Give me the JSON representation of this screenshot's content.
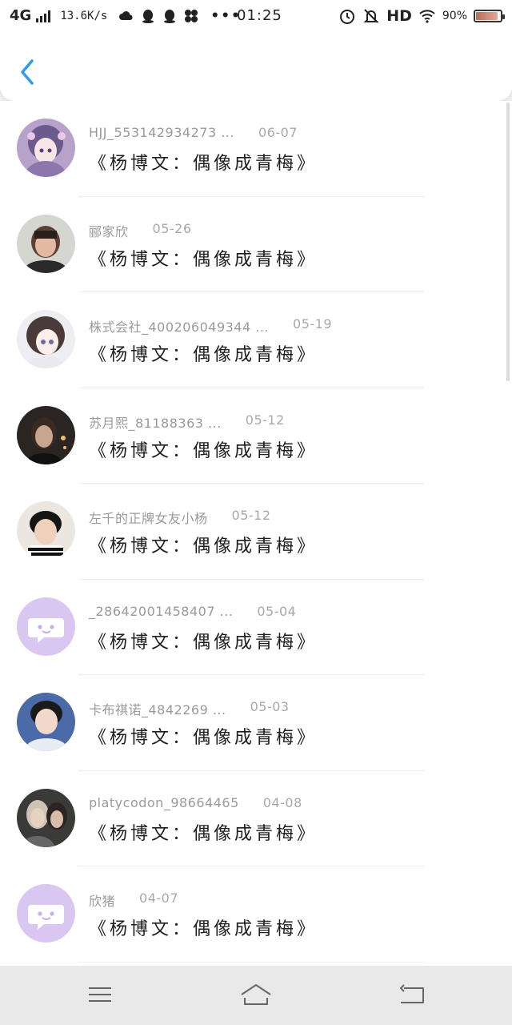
{
  "status_bar": {
    "network": "4G",
    "speed": "13.6K/s",
    "more": "•••",
    "time": "01:25",
    "hd": "HD",
    "battery_percent": "90%",
    "battery_level": 0.9,
    "icons": [
      "cloud-icon",
      "qq-icon",
      "qq-icon",
      "pinwheel-icon"
    ]
  },
  "nav": {
    "back_icon": "chevron-left-icon",
    "accent": "#2b9cf0"
  },
  "list": {
    "items": [
      {
        "user": "HJJ_553142934273 ...",
        "date": "06-07",
        "title": "《杨博文：偶像成青梅》",
        "avatar": "anime-girl-purple"
      },
      {
        "user": "郦家欣",
        "date": "05-26",
        "title": "《杨博文：偶像成青梅》",
        "avatar": "photo-girl"
      },
      {
        "user": "株式会社_400206049344 ...",
        "date": "05-19",
        "title": "《杨博文：偶像成青梅》",
        "avatar": "anime-girl-brown"
      },
      {
        "user": "苏月熙_81188363 ...",
        "date": "05-12",
        "title": "《杨博文：偶像成青梅》",
        "avatar": "photo-dark"
      },
      {
        "user": "左千的正牌女友小杨",
        "date": "05-12",
        "title": "《杨博文：偶像成青梅》",
        "avatar": "photo-boy-scarf"
      },
      {
        "user": "_28642001458407 ...",
        "date": "05-04",
        "title": "《杨博文：偶像成青梅》",
        "avatar": "default-purple"
      },
      {
        "user": "卡布祺诺_4842269 ...",
        "date": "05-03",
        "title": "《杨博文：偶像成青梅》",
        "avatar": "photo-boy-blue"
      },
      {
        "user": "platycodon_98664465",
        "date": "04-08",
        "title": "《杨博文：偶像成青梅》",
        "avatar": "photo-couple"
      },
      {
        "user": "欣猪",
        "date": "04-07",
        "title": "《杨博文：偶像成青梅》",
        "avatar": "default-purple"
      }
    ]
  },
  "bottom_bar": {
    "menu_icon": "menu-icon",
    "home_icon": "home-icon",
    "back_icon": "return-icon"
  }
}
